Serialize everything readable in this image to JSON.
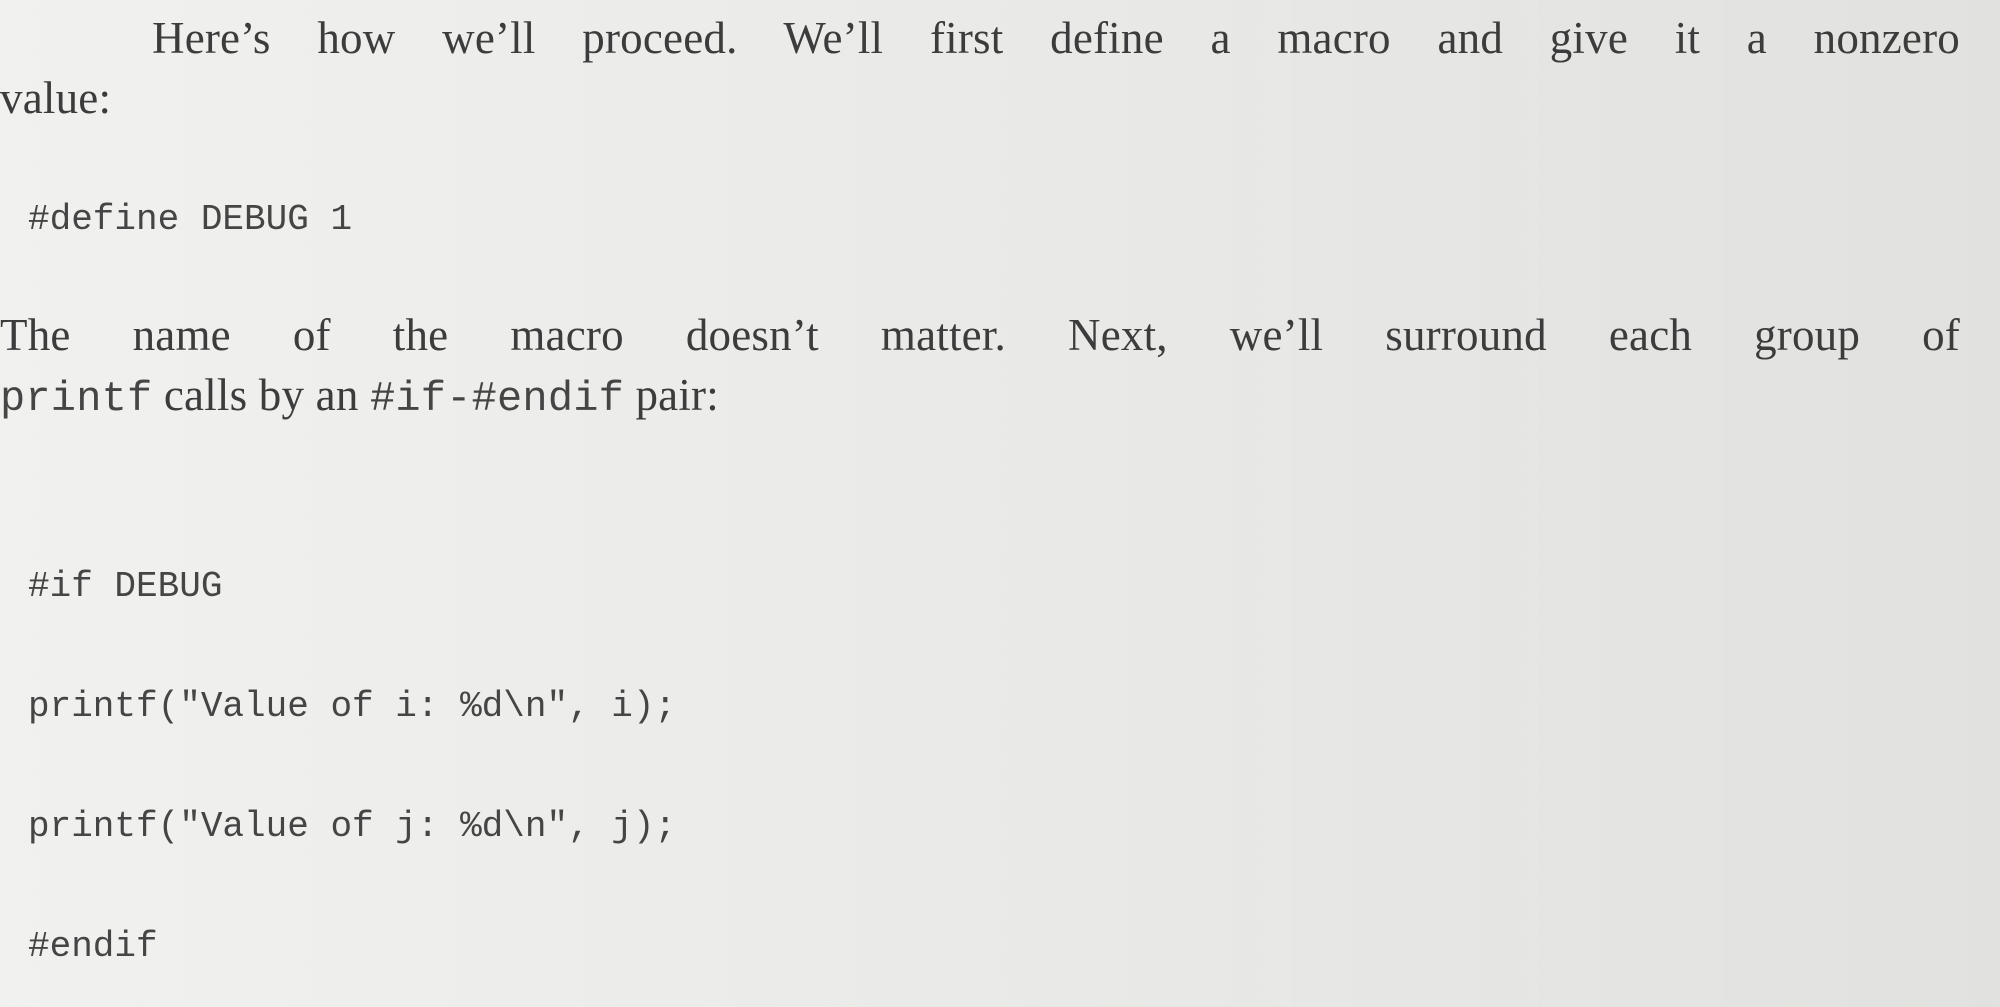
{
  "document": {
    "para1_line1": "Here’s how we’ll proceed. We’ll first define a macro and give it a nonzero",
    "para1_line2": "value:",
    "code_define": "#define DEBUG 1",
    "para2_line1": "The name of the macro doesn’t matter. Next, we’ll surround each group of",
    "para2_line2": {
      "code_printf": "printf",
      "text_mid": " calls by an ",
      "code_ifendif": "#if-#endif",
      "text_end": " pair:"
    },
    "code_block": [
      "#if DEBUG",
      "printf(\"Value of i: %d\\n\", i);",
      "printf(\"Value of j: %d\\n\", j);",
      "#endif"
    ]
  }
}
